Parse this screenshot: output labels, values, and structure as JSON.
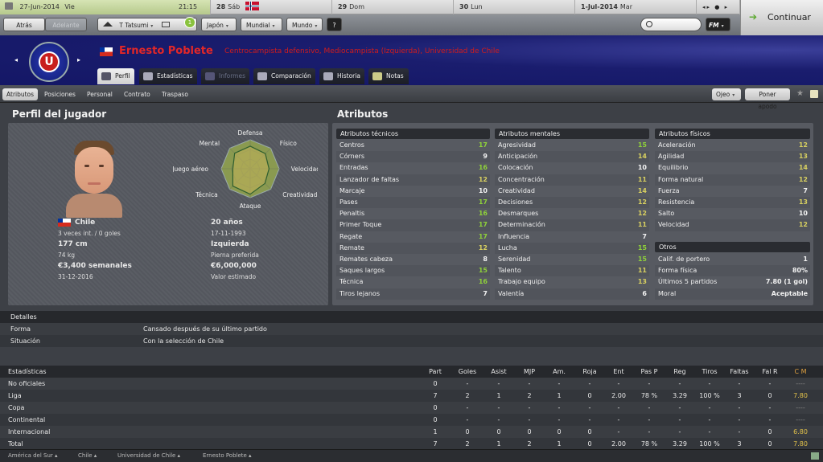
{
  "calendar": {
    "date": "27-Jun-2014",
    "day": "Vie",
    "time": "21:15",
    "days": [
      {
        "num": "28",
        "name": "Sáb"
      },
      {
        "num": "29",
        "name": "Dom"
      },
      {
        "num": "30",
        "name": "Lun"
      },
      {
        "num": "1-Jul-2014",
        "name": "Mar"
      }
    ]
  },
  "nav": {
    "back": "Atrás",
    "forward": "Adelante",
    "manager": "T Tatsumi",
    "japan": "Japón",
    "world_cup": "Mundial",
    "world": "Mundo",
    "help": "?",
    "badge": "1",
    "fm_label": "FM",
    "continue": "Continuar"
  },
  "player": {
    "name": "Ernesto Poblete",
    "role": "Centrocampista defensivo, Mediocampista (Izquierda), Universidad de Chile",
    "nationality": "Chile",
    "caps": "3 veces int. / 0 goles",
    "age": "20 años",
    "dob": "17-11-1993",
    "height": "177 cm",
    "weight": "74 kg",
    "foot": "Izquierda",
    "foot_label": "Pierna preferida",
    "wage": "€3,400 semanales",
    "contract": "31-12-2016",
    "value": "€6,000,000",
    "value_label": "Valor estimado"
  },
  "tabs": [
    "Perfil",
    "Estadísticas",
    "Informes",
    "Comparación",
    "Historia",
    "Notas"
  ],
  "subtabs": [
    "Atributos",
    "Posiciones",
    "Personal",
    "Contrato",
    "Traspaso"
  ],
  "sub_right": {
    "scout": "Ojeo",
    "support": "Poner apodo"
  },
  "sections": {
    "profile": "Perfil del jugador",
    "attributes": "Atributos"
  },
  "radar": {
    "labels": [
      "Defensa",
      "Físico",
      "Velocidad",
      "Creatividad",
      "Ataque",
      "Técnica",
      "Juego aéreo",
      "Mental"
    ],
    "values": [
      0.78,
      0.74,
      0.65,
      0.72,
      0.88,
      0.85,
      0.6,
      0.76
    ],
    "color": "#c4b45a"
  },
  "technical": {
    "title": "Atributos técnicos",
    "rows": [
      [
        "Centros",
        "17"
      ],
      [
        "Córners",
        "9"
      ],
      [
        "Entradas",
        "16"
      ],
      [
        "Lanzador de faltas",
        "12"
      ],
      [
        "Marcaje",
        "10"
      ],
      [
        "Pases",
        "17"
      ],
      [
        "Penaltis",
        "16"
      ],
      [
        "Primer Toque",
        "17"
      ],
      [
        "Regate",
        "17"
      ],
      [
        "Remate",
        "12"
      ],
      [
        "Remates cabeza",
        "8"
      ],
      [
        "Saques largos",
        "15"
      ],
      [
        "Técnica",
        "16"
      ],
      [
        "Tiros lejanos",
        "7"
      ]
    ]
  },
  "mental": {
    "title": "Atributos mentales",
    "rows": [
      [
        "Agresividad",
        "15"
      ],
      [
        "Anticipación",
        "14"
      ],
      [
        "Colocación",
        "10"
      ],
      [
        "Concentración",
        "11"
      ],
      [
        "Creatividad",
        "14"
      ],
      [
        "Decisiones",
        "12"
      ],
      [
        "Desmarques",
        "12"
      ],
      [
        "Determinación",
        "11"
      ],
      [
        "Influencia",
        "7"
      ],
      [
        "Lucha",
        "15"
      ],
      [
        "Serenidad",
        "15"
      ],
      [
        "Talento",
        "11"
      ],
      [
        "Trabajo equipo",
        "13"
      ],
      [
        "Valentía",
        "6"
      ]
    ]
  },
  "physical": {
    "title": "Atributos físicos",
    "rows": [
      [
        "Aceleración",
        "12"
      ],
      [
        "Agilidad",
        "13"
      ],
      [
        "Equilibrio",
        "14"
      ],
      [
        "Forma natural",
        "12"
      ],
      [
        "Fuerza",
        "7"
      ],
      [
        "Resistencia",
        "13"
      ],
      [
        "Salto",
        "10"
      ],
      [
        "Velocidad",
        "12"
      ]
    ]
  },
  "others": {
    "title": "Otros",
    "rows": [
      [
        "Calif. de portero",
        "1"
      ],
      [
        "Forma física",
        "80%"
      ],
      [
        "Últimos 5 partidos",
        "7.80 (1 gol)"
      ],
      [
        "Moral",
        "Aceptable"
      ]
    ]
  },
  "details": {
    "title": "Detalles",
    "rows": [
      [
        "Forma",
        "Cansado después de su último partido"
      ],
      [
        "Situación",
        "Con la selección de Chile"
      ]
    ]
  },
  "stats": {
    "headers": [
      "Estadísticas",
      "Part",
      "Goles",
      "Asist",
      "MJP",
      "Am.",
      "Roja",
      "Ent",
      "Pas P",
      "Reg",
      "Tiros",
      "Faltas",
      "Fal R",
      "C M"
    ],
    "rows": [
      [
        "No oficiales",
        "0",
        "-",
        "-",
        "-",
        "-",
        "-",
        "-",
        "-",
        "-",
        "-",
        "-",
        "-",
        "----"
      ],
      [
        "Liga",
        "7",
        "2",
        "1",
        "2",
        "1",
        "0",
        "2.00",
        "78 %",
        "3.29",
        "100 %",
        "3",
        "0",
        "7.80"
      ],
      [
        "Copa",
        "0",
        "-",
        "-",
        "-",
        "-",
        "-",
        "-",
        "-",
        "-",
        "-",
        "-",
        "-",
        "----"
      ],
      [
        "Continental",
        "0",
        "-",
        "-",
        "-",
        "-",
        "-",
        "-",
        "-",
        "-",
        "-",
        "-",
        "-",
        "----"
      ],
      [
        "Internacional",
        "1",
        "0",
        "0",
        "0",
        "0",
        "0",
        "-",
        "-",
        "-",
        "-",
        "-",
        "0",
        "6.80"
      ],
      [
        "Total",
        "7",
        "2",
        "1",
        "2",
        "1",
        "0",
        "2.00",
        "78 %",
        "3.29",
        "100 %",
        "3",
        "0",
        "7.80"
      ]
    ]
  },
  "breadcrumbs": [
    "América del Sur",
    "Chile",
    "Universidad de Chile",
    "Ernesto Poblete"
  ]
}
